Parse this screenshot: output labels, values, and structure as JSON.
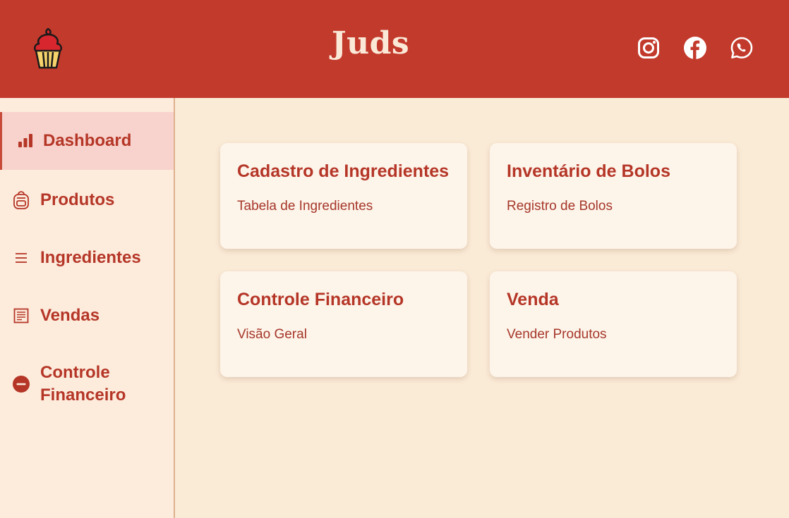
{
  "header": {
    "brand": "Juds",
    "logo_icon": "cupcake-icon",
    "social": [
      {
        "icon": "instagram-icon"
      },
      {
        "icon": "facebook-icon"
      },
      {
        "icon": "whatsapp-icon"
      }
    ]
  },
  "sidebar": {
    "items": [
      {
        "label": "Dashboard",
        "icon": "bar-chart-icon",
        "active": true
      },
      {
        "label": "Produtos",
        "icon": "backpack-icon"
      },
      {
        "label": "Ingredientes",
        "icon": "list-icon"
      },
      {
        "label": "Vendas",
        "icon": "receipt-icon"
      },
      {
        "label": "Controle Financeiro",
        "icon": "minus-circle-icon"
      }
    ]
  },
  "cards": [
    {
      "title": "Cadastro de Ingredientes",
      "subtitle": "Tabela de Ingredientes"
    },
    {
      "title": "Inventário de Bolos",
      "subtitle": "Registro de Bolos"
    },
    {
      "title": "Controle Financeiro",
      "subtitle": "Visão Geral"
    },
    {
      "title": "Venda",
      "subtitle": "Vender Produtos"
    }
  ],
  "colors": {
    "header_bg": "#c23a2c",
    "page_bg": "#faebd7",
    "sidebar_bg": "#fdebdc",
    "active_bg": "#f8d2cc",
    "accent": "#b53627",
    "card_bg": "#fdf4ea",
    "brand_text": "#fbe9d8"
  }
}
